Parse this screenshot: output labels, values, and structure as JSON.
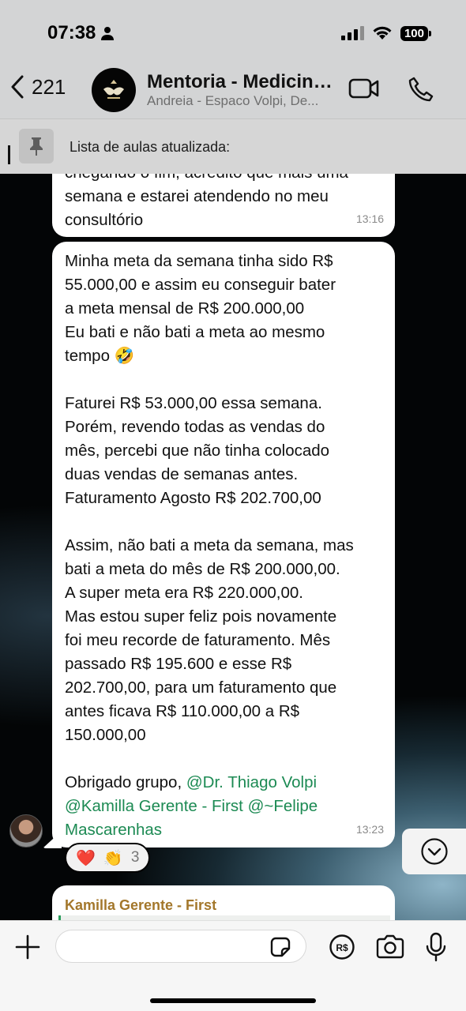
{
  "status_bar": {
    "time": "07:38",
    "battery": "100"
  },
  "header": {
    "back_count": "221",
    "title": "Mentoria - Medicina...",
    "subtitle": "Andreia - Espaco Volpi, De..."
  },
  "pinned": {
    "text": "Lista de aulas atualizada:"
  },
  "messages": {
    "previous": {
      "lines": [
        "chegando o fim, acredito que mais uma",
        "semana e estarei atendendo no meu",
        "consultório"
      ],
      "time": "13:16"
    },
    "main": {
      "p1": [
        "Minha meta da semana tinha sido R$",
        "55.000,00 e assim eu conseguir bater",
        "a meta mensal de R$ 200.000,00",
        "Eu bati e não bati a meta ao mesmo",
        "tempo 🤣"
      ],
      "p2": [
        "Faturei R$ 53.000,00 essa semana.",
        "Porém, revendo todas as vendas do",
        "mês, percebi que não tinha colocado",
        "duas vendas de semanas antes.",
        "Faturamento Agosto R$ 202.700,00"
      ],
      "p3": [
        "Assim, não bati a meta da semana, mas",
        "bati a meta do mês de R$ 200.000,00.",
        "A super meta era R$ 220.000,00.",
        "Mas estou super feliz pois novamente",
        "foi meu recorde de faturamento. Mês",
        "passado R$ 195.600 e esse R$",
        "202.700,00, para um faturamento que",
        "antes ficava R$ 110.000,00 a R$",
        "150.000,00"
      ],
      "thanks_prefix": "Obrigado grupo, ",
      "mention_1": "@Dr. Thiago Volpi",
      "mention_2": "@Kamilla Gerente - First",
      "mention_3a": "@~Felipe",
      "mention_3b": "Mascarenhas",
      "time": "13:23",
      "reactions": {
        "emoji_1": "❤️",
        "emoji_2": "👏",
        "count": "3"
      }
    },
    "next": {
      "sender": "Kamilla Gerente - First"
    }
  },
  "composer": {
    "placeholder": ""
  },
  "icons": [
    "person-icon",
    "signal-icon",
    "wifi-icon",
    "battery-icon",
    "back-chevron-icon",
    "video-call-icon",
    "phone-icon",
    "pin-icon",
    "chevron-down-icon",
    "plus-icon",
    "sticker-icon",
    "payment-icon",
    "camera-icon",
    "microphone-icon"
  ]
}
